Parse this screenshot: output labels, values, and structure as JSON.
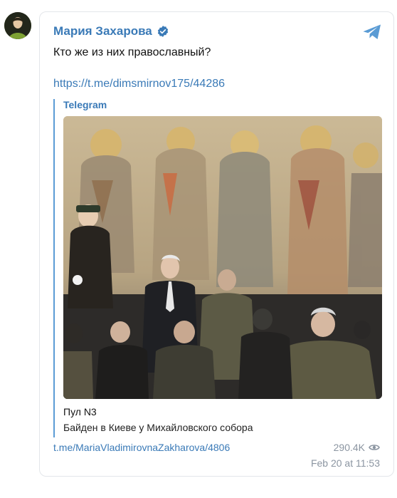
{
  "author": {
    "name": "Мария Захарова",
    "verified_icon": "verified-badge-icon",
    "avatar": "avatar"
  },
  "post": {
    "text": "Кто же из них православный?",
    "link": "https://t.me/dimsmirnov175/44286"
  },
  "preview": {
    "source": "Telegram",
    "title": "Пул N3",
    "description": "Байден в Киеве у Михайловского собора"
  },
  "footer": {
    "channel_link": "t.me/MariaVladimirovnaZakharova/4806",
    "views": "290.4K",
    "date": "Feb 20 at 11:53"
  },
  "colors": {
    "accent": "#3a7ab7",
    "border": "#5b9bd5",
    "muted": "#8b95a1"
  }
}
